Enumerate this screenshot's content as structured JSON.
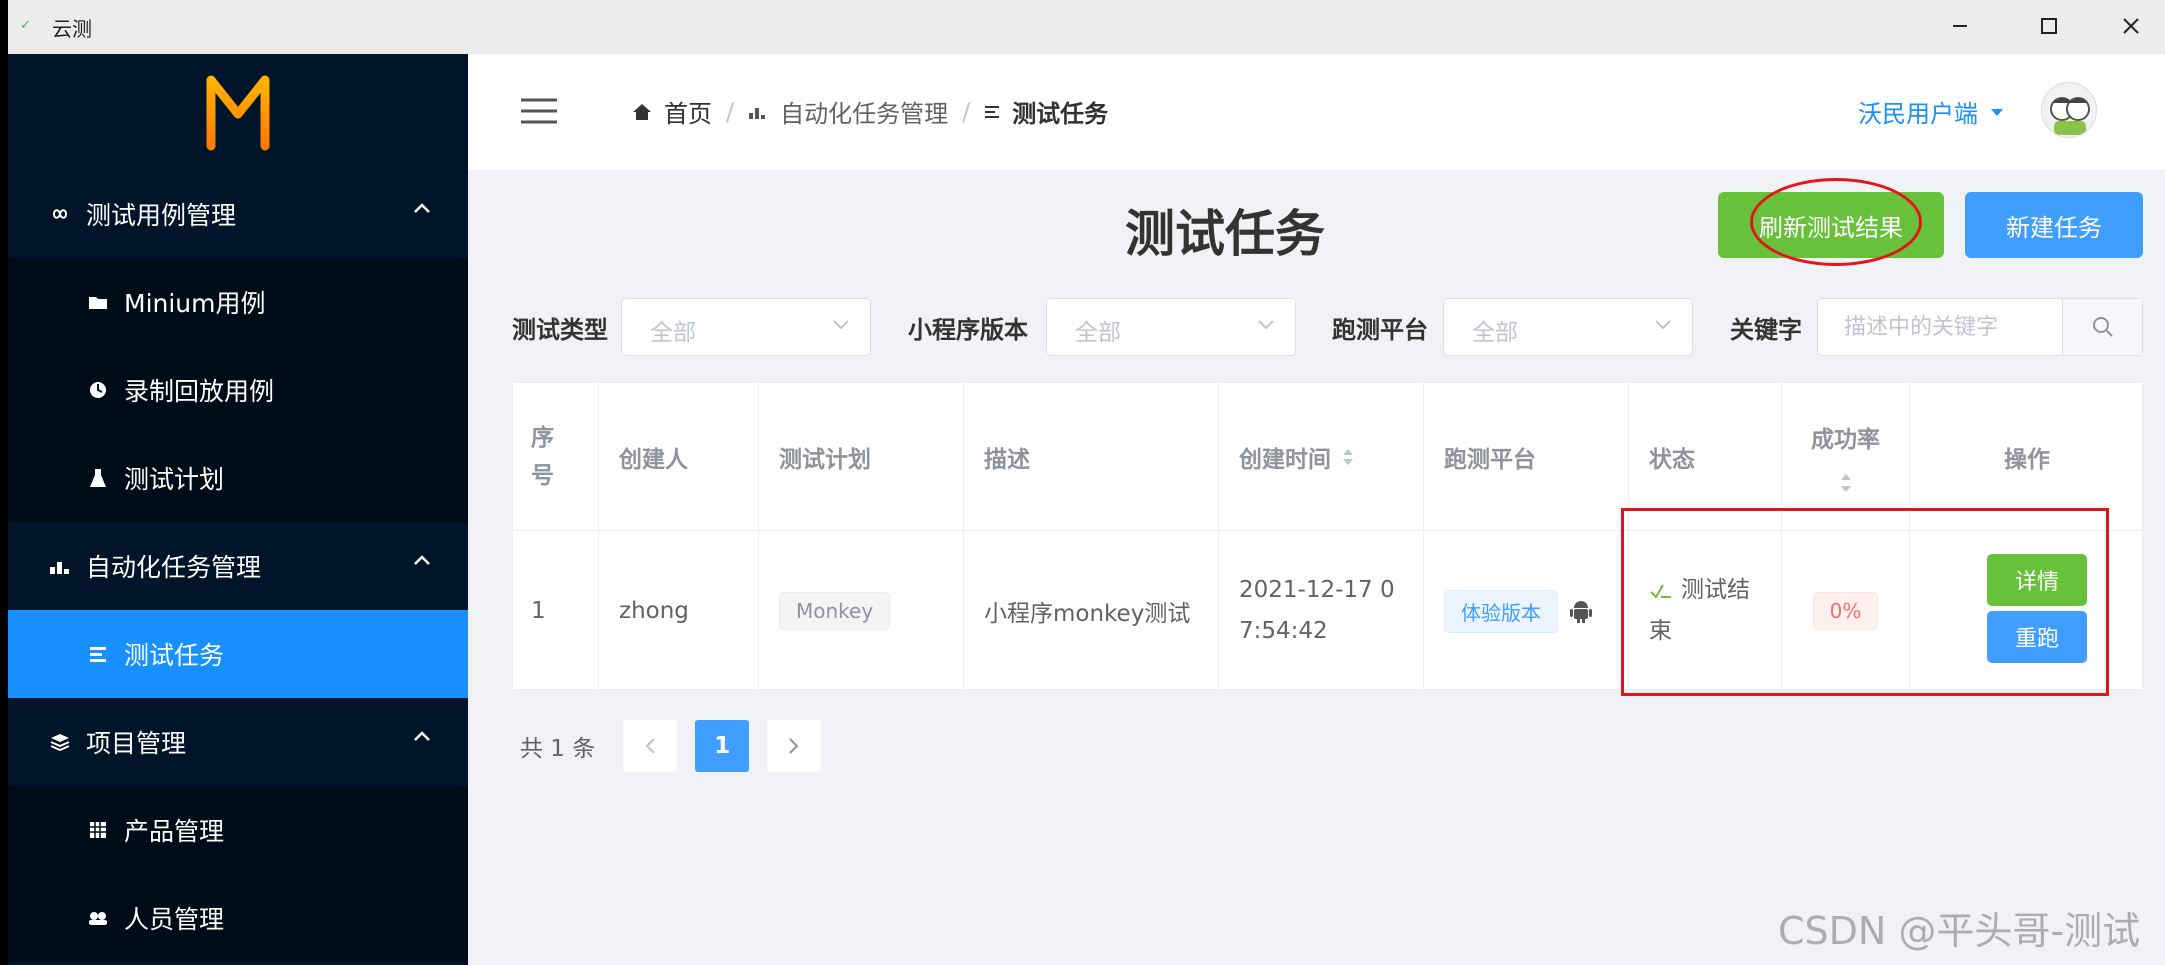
{
  "window": {
    "title": "云测"
  },
  "sidebar": {
    "logo": "M",
    "groups": [
      {
        "label": "测试用例管理",
        "icon": "infinity-icon",
        "items": [
          {
            "label": "Minium用例",
            "icon": "folder-icon"
          },
          {
            "label": "录制回放用例",
            "icon": "record-icon"
          },
          {
            "label": "测试计划",
            "icon": "flask-icon"
          }
        ]
      },
      {
        "label": "自动化任务管理",
        "icon": "chart-icon",
        "items": [
          {
            "label": "测试任务",
            "icon": "list-icon",
            "active": true
          }
        ]
      },
      {
        "label": "项目管理",
        "icon": "layers-icon",
        "items": [
          {
            "label": "产品管理",
            "icon": "grid-icon"
          },
          {
            "label": "人员管理",
            "icon": "people-icon"
          }
        ]
      }
    ]
  },
  "header": {
    "breadcrumb": [
      "首页",
      "自动化任务管理",
      "测试任务"
    ],
    "user": "沃民用户端"
  },
  "main": {
    "title": "测试任务",
    "refresh_label": "刷新测试结果",
    "new_label": "新建任务",
    "filters": {
      "type_label": "测试类型",
      "type_value": "全部",
      "version_label": "小程序版本",
      "version_value": "全部",
      "platform_label": "跑测平台",
      "platform_value": "全部",
      "keyword_label": "关键字",
      "keyword_placeholder": "描述中的关键字"
    },
    "table": {
      "columns": [
        "序号",
        "创建人",
        "测试计划",
        "描述",
        "创建时间",
        "跑测平台",
        "状态",
        "成功率",
        "操作"
      ],
      "rows": [
        {
          "index": "1",
          "creator": "zhong",
          "plan": "Monkey",
          "desc": "小程序monkey测试",
          "created_line1": "2021-12-17 0",
          "created_line2": "7:54:42",
          "platform": "体验版本",
          "status_line1": "测试结",
          "status_line2": "束",
          "success_rate": "0%",
          "detail_label": "详情",
          "rerun_label": "重跑"
        }
      ]
    },
    "pagination": {
      "total": "共 1 条",
      "current": "1"
    }
  },
  "watermark": "CSDN @平头哥-测试",
  "colors": {
    "sidebar_bg": "#001529",
    "accent": "#1890ff",
    "success": "#67c23a",
    "annotation_red": "#e5141b"
  }
}
